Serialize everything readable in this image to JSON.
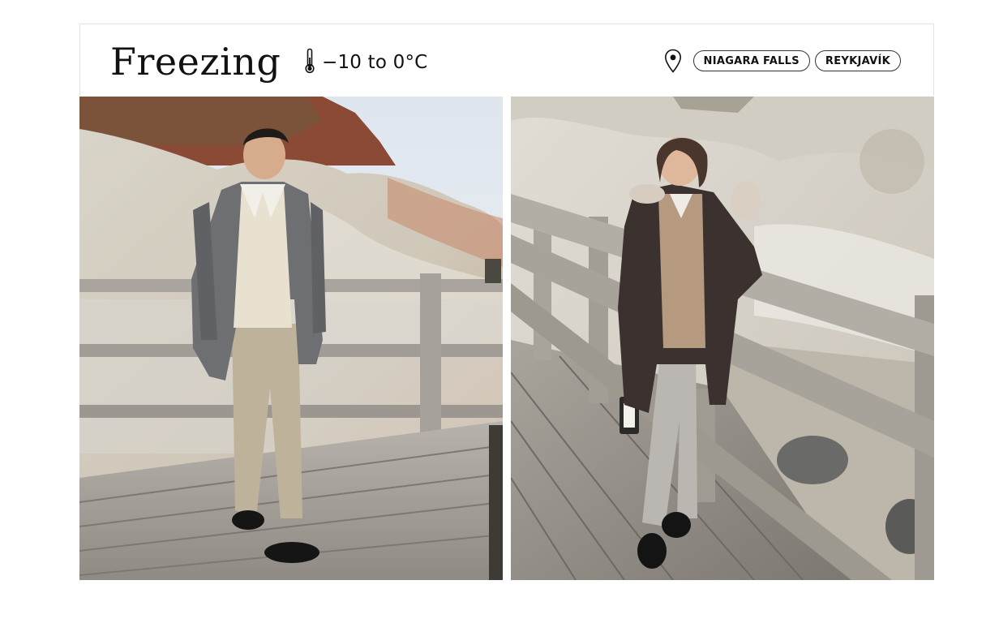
{
  "header": {
    "title": "Freezing",
    "temperature": "−10 to 0°C",
    "temperature_icon": "thermometer-icon",
    "location_icon": "map-pin-icon",
    "locations": [
      "NIAGARA FALLS",
      "REYKJAVÍK"
    ]
  },
  "photos": [
    {
      "subject": "man-in-grey-parka-on-boardwalk"
    },
    {
      "subject": "woman-in-dark-hooded-coat-leaning-on-railing"
    }
  ],
  "colors": {
    "header_border": "#e2e2e2",
    "chip_border": "#333333",
    "text": "#111111"
  }
}
